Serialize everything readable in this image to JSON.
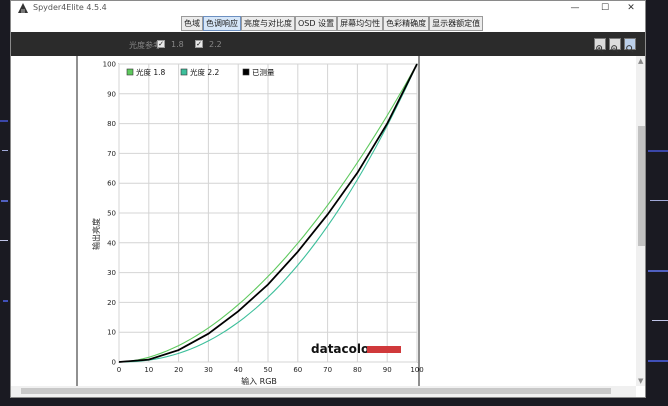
{
  "window": {
    "title": "Spyder4Elite 4.5.4"
  },
  "window_controls": {
    "minimize": "—",
    "maximize": "☐",
    "close": "✕"
  },
  "tabs": [
    {
      "label": "色域",
      "active": false
    },
    {
      "label": "色调响应",
      "active": true
    },
    {
      "label": "亮度与对比度",
      "active": false
    },
    {
      "label": "OSD 设置",
      "active": false
    },
    {
      "label": "屏幕均匀性",
      "active": false
    },
    {
      "label": "色彩精确度",
      "active": false
    },
    {
      "label": "显示器额定值",
      "active": false
    }
  ],
  "toolbar": {
    "gamma_label": "光度参考:",
    "options": [
      {
        "label": "1.8",
        "checked": true
      },
      {
        "label": "2.2",
        "checked": true
      }
    ],
    "zoom_icons": [
      "zoom-in-icon",
      "zoom-out-icon",
      "zoom-fit-icon"
    ]
  },
  "brand": {
    "text": "datacolor",
    "bar_color": "#d0393b"
  },
  "chart_data": {
    "type": "line",
    "xlabel": "输入 RGB",
    "ylabel": "输出亮度",
    "xlim": [
      0,
      100
    ],
    "ylim": [
      0,
      100
    ],
    "xticks": [
      "0",
      "10",
      "20",
      "30",
      "40",
      "50",
      "60",
      "70",
      "80",
      "90",
      "100"
    ],
    "yticks": [
      "0",
      "10",
      "20",
      "30",
      "40",
      "50",
      "60",
      "70",
      "80",
      "90",
      "100"
    ],
    "grid": true,
    "legend": "top-left",
    "series": [
      {
        "name": "光度 1.8",
        "color": "#5ec95e",
        "gamma": 1.8
      },
      {
        "name": "光度 2.2",
        "color": "#3dbf9b",
        "gamma": 2.2
      },
      {
        "name": "已测量",
        "color": "#000000",
        "x": [
          0,
          10,
          20,
          30,
          40,
          50,
          60,
          70,
          80,
          90,
          100
        ],
        "y": [
          0,
          0.8,
          4,
          9.5,
          17,
          26,
          37,
          49.5,
          63.5,
          80,
          100
        ]
      }
    ]
  }
}
